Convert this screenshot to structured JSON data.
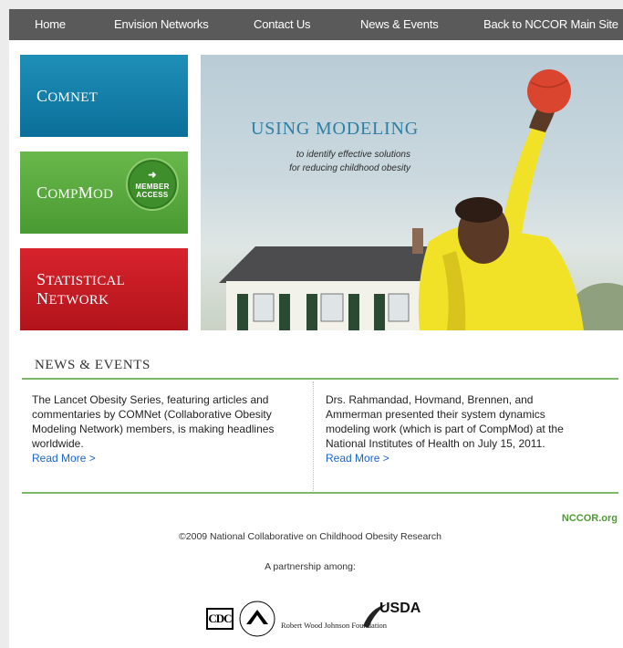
{
  "nav": {
    "home": "Home",
    "envision": "Envision Networks",
    "contact": "Contact Us",
    "news": "News & Events",
    "back": "Back to NCCOR Main Site"
  },
  "tiles": {
    "comnet_cap": "C",
    "comnet_rest": "OMN",
    "comnet_tail": "ET",
    "compmod_cap": "C",
    "compmod_rest": "OMP",
    "compmod_m": "M",
    "compmod_tail": "OD",
    "stat_s": "S",
    "stat_rest": "TATISTICAL",
    "stat_n": "N",
    "stat_tail": "ETWORK",
    "member_line1": "MEMBER",
    "member_line2": "ACCESS"
  },
  "hero": {
    "title": "USING MODELING",
    "sub1": "to identify effective solutions",
    "sub2": "for reducing childhood obesity"
  },
  "news": {
    "heading": "NEWS & EVENTS",
    "left_text": "The Lancet Obesity Series, featuring articles and commentaries by COMNet (Collaborative Obesity Modeling Network) members, is making headlines worldwide.",
    "left_link": "Read More >",
    "right_text": "Drs. Rahmandad, Hovmand, Brennen, and Ammerman presented their system dynamics modeling work (which is part of CompMod) at the National Institutes of Health on July 15, 2011.",
    "right_link": "Read More >"
  },
  "footer": {
    "nccor_link": "NCCOR.org",
    "copyright": "©2009 National Collaborative on Childhood Obesity Research",
    "partnership": "A partnership among:",
    "logo_cdc": "CDC",
    "logo_nih": "NATIONAL INSTITUTES OF HEALTH",
    "logo_rwjf": "Robert Wood Johnson Foundation",
    "logo_usda": "USDA"
  },
  "colors": {
    "nav_bg": "#5a5a5a",
    "comnet": "#1281ad",
    "compmod": "#5aaa3f",
    "statistical": "#c81c24",
    "link": "#1a64c8",
    "accent_green": "#7bb86a"
  }
}
